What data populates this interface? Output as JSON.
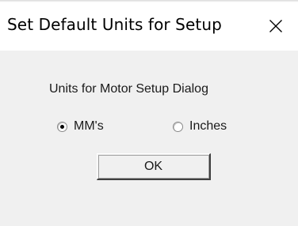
{
  "window": {
    "title": "Set Default Units for Setup"
  },
  "titlebar": {
    "close_icon": "close-icon"
  },
  "dialog": {
    "prompt": "Units for Motor Setup Dialog",
    "options": [
      {
        "label": "MM's",
        "selected": true
      },
      {
        "label": "Inches",
        "selected": false
      }
    ],
    "ok_label": "OK"
  }
}
